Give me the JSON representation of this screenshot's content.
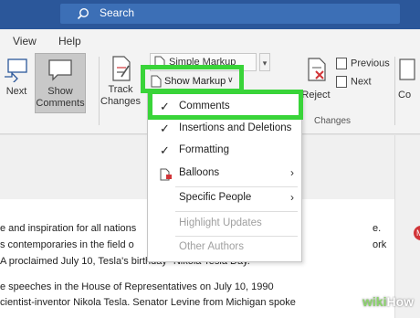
{
  "titlebar": {
    "search_label": "Search"
  },
  "ribbon": {
    "tabs": [
      "View",
      "Help"
    ],
    "next_label": "Next",
    "show_comments_label": "Show Comments",
    "track_changes_label": "Track Changes",
    "simple_markup_label": "Simple Markup",
    "show_markup_label": "Show Markup",
    "reject_label": "Reject",
    "previous_label": "Previous",
    "next2_label": "Next",
    "changes_group_label": "Changes",
    "right_partial_label": "Co"
  },
  "menu": {
    "items": [
      {
        "label": "Comments",
        "checked": true
      },
      {
        "label": "Insertions and Deletions",
        "checked": true
      },
      {
        "label": "Formatting",
        "checked": true
      },
      {
        "label": "Balloons",
        "submenu": true
      },
      {
        "label": "Specific People",
        "submenu": true
      },
      {
        "label": "Highlight Updates",
        "disabled": true
      },
      {
        "label": "Other Authors",
        "disabled": true
      }
    ]
  },
  "document": {
    "lines": [
      "e and inspiration for all nations",
      "s contemporaries in the field o",
      "A proclaimed July 10, Tesla's birthday \"Nikola Tesla Day.\"",
      "e speeches in the House of Representatives on July 10, 1990",
      "cientist-inventor Nikola Tesla. Senator Levine from Michigan spoke"
    ],
    "line_tails": [
      "e.",
      "ork"
    ],
    "avatar_initial": "M"
  },
  "watermark": {
    "part1": "wiki",
    "part2": "How"
  },
  "colors": {
    "title_bar": "#2b579a",
    "highlight": "#39d439"
  }
}
